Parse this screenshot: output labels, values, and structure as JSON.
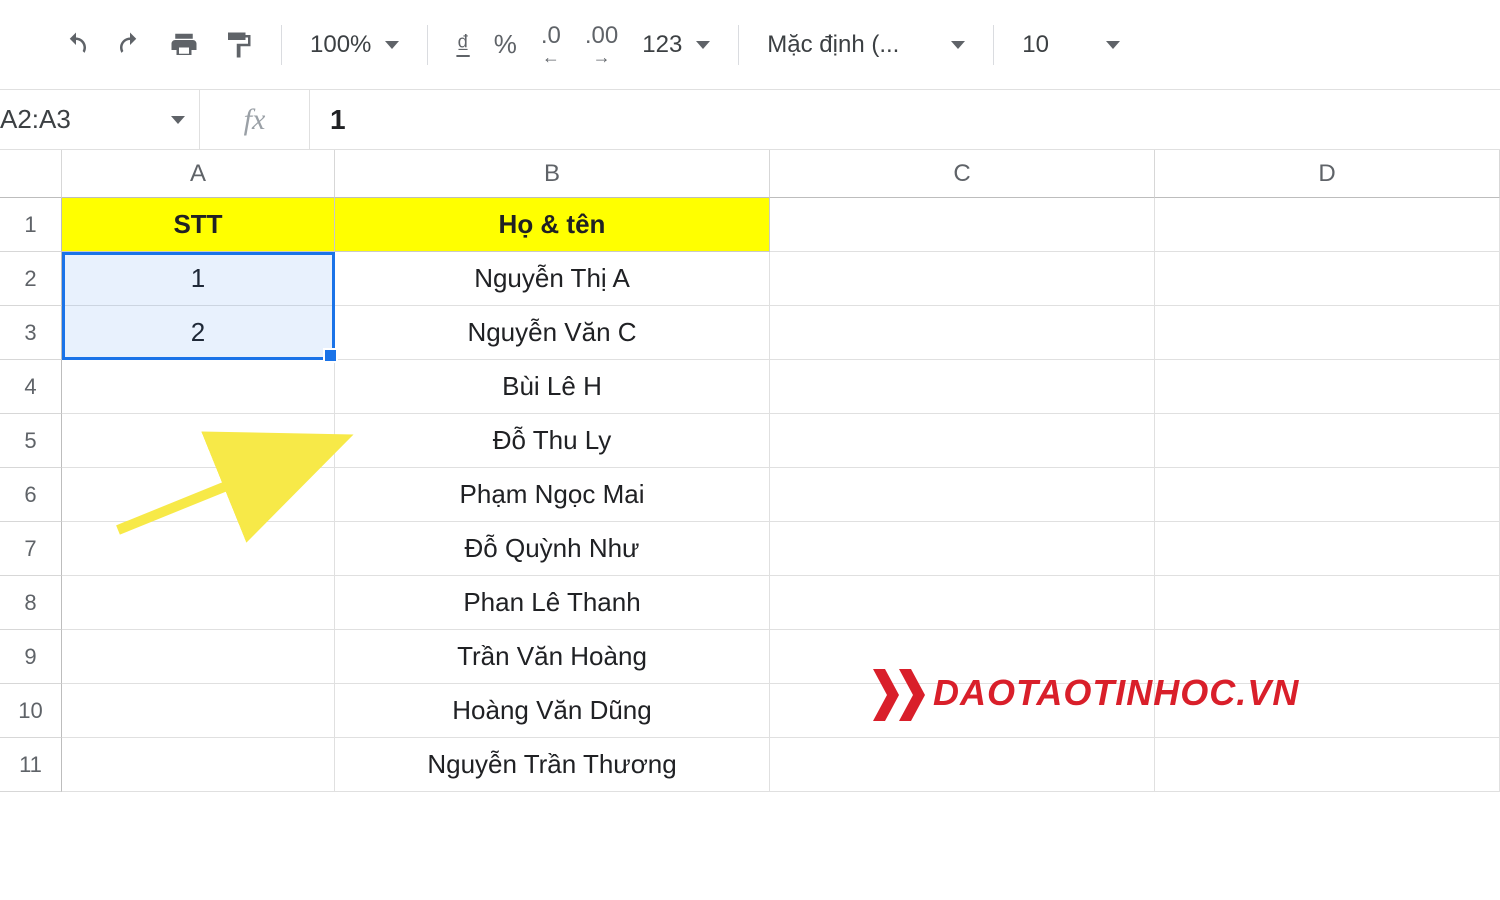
{
  "toolbar": {
    "zoom": "100%",
    "currency_symbol": "₫",
    "percent": "%",
    "dec_less": ".0",
    "dec_more": ".00",
    "more_formats": "123",
    "font": "Mặc định (...",
    "font_size": "10"
  },
  "formula_bar": {
    "name_box": "A2:A3",
    "fx_label": "fx",
    "formula_value": "1"
  },
  "columns": [
    "A",
    "B",
    "C",
    "D"
  ],
  "row_numbers": [
    "1",
    "2",
    "3",
    "4",
    "5",
    "6",
    "7",
    "8",
    "9",
    "10",
    "11"
  ],
  "headers": {
    "stt": "STT",
    "name": "Họ & tên"
  },
  "data": {
    "stt": [
      "1",
      "2",
      "",
      "",
      "",
      "",
      "",
      "",
      "",
      ""
    ],
    "names": [
      "Nguyễn Thị A",
      "Nguyễn Văn C",
      "Bùi Lê H",
      "Đỗ Thu Ly",
      "Phạm Ngọc Mai",
      "Đỗ Quỳnh Như",
      "Phan Lê Thanh",
      "Trần Văn Hoàng",
      "Hoàng Văn Dũng",
      "Nguyễn Trần Thương"
    ]
  },
  "watermark": "DAOTAOTINHOC.VN"
}
